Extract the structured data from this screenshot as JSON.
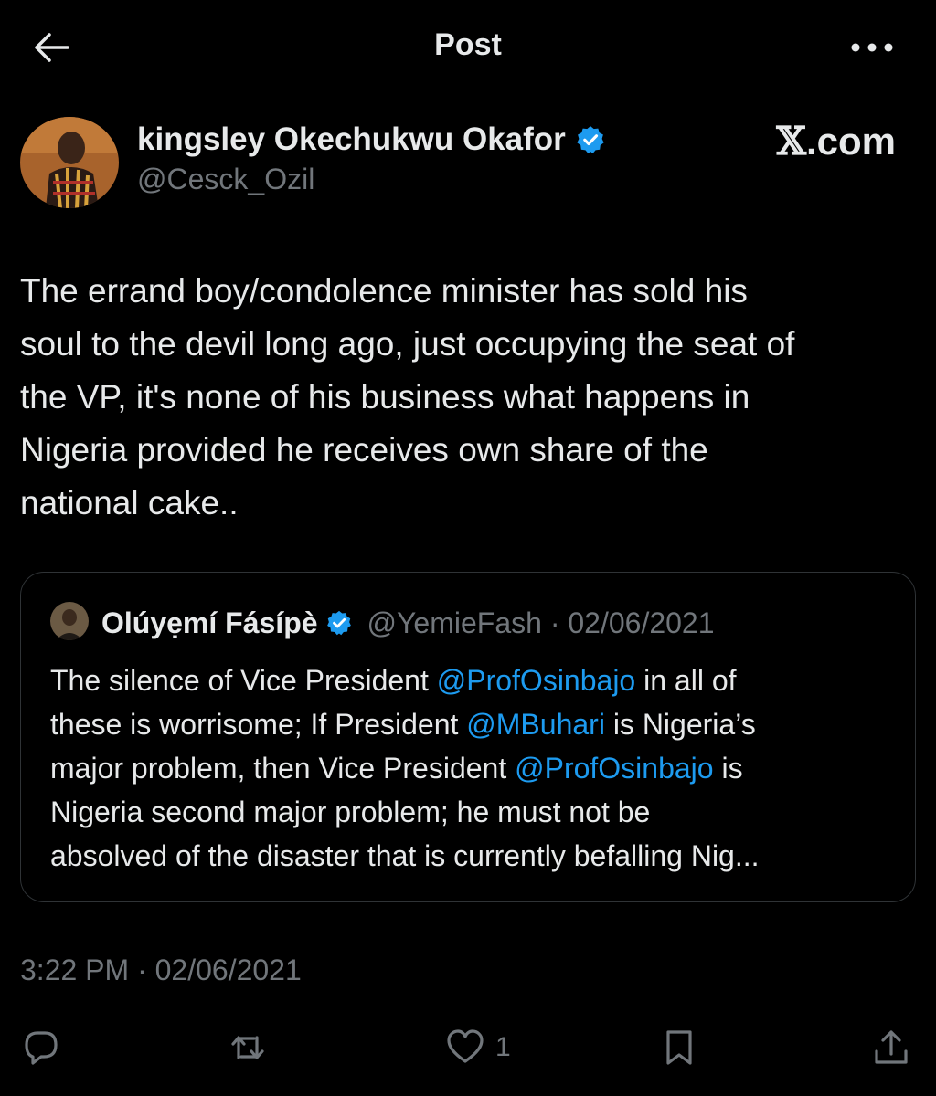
{
  "header": {
    "title": "Post"
  },
  "author": {
    "name": "kingsley Okechukwu Okafor",
    "handle": "@Cesck_Ozil"
  },
  "brand": {
    "x": "𝕏",
    "domain": ".com"
  },
  "post": {
    "lines": [
      "The errand boy/condolence minister has sold his",
      "soul to the devil long ago, just occupying the seat of",
      "the VP, it's none of his business what happens in",
      "Nigeria provided he receives own share of the",
      "national cake.."
    ]
  },
  "quote": {
    "name": "Olúyẹmí Fásípè",
    "handle": "@YemieFash · 02/06/2021",
    "line1_a": "The silence of Vice President ",
    "line1_mention": "@ProfOsinbajo",
    "line1_b": " in all of",
    "line2_a": "these is worrisome; If President ",
    "line2_mention": "@MBuhari",
    "line2_b": " is Nigeria’s",
    "line3_a": "major problem, then Vice President ",
    "line3_mention": "@ProfOsinbajo",
    "line3_b": " is",
    "line4": "Nigeria second major problem; he must not be",
    "line5": "absolved of the disaster that is currently befalling Nig..."
  },
  "timestamp": "3:22 PM · 02/06/2021",
  "actions": {
    "like_count": "1"
  },
  "colors": {
    "background": "#000000",
    "text": "#e7e9ea",
    "muted": "#71767b",
    "accent": "#1d9bf0",
    "border": "#2f3336"
  },
  "icons": {
    "back": "arrow-left-icon",
    "more": "more-dots-icon",
    "verified": "verified-badge-icon",
    "reply": "reply-icon",
    "repost": "repost-icon",
    "like": "heart-icon",
    "bookmark": "bookmark-icon",
    "share": "share-icon"
  }
}
